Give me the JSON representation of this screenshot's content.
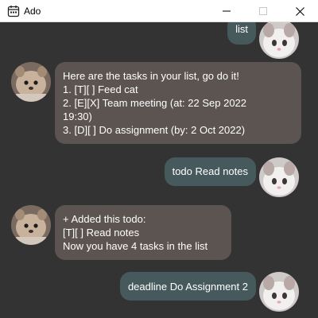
{
  "window": {
    "title": "Ado",
    "icon": "calendar-icon",
    "controls": [
      "minimize-icon",
      "maximize-icon",
      "close-icon"
    ]
  },
  "colors": {
    "background": "#333333",
    "user_bubble": "#465a5d",
    "bot_bubble": "#5b5450",
    "text": "#ffffff"
  },
  "messages": [
    {
      "sender": "user",
      "text": "list"
    },
    {
      "sender": "bot",
      "text": "Here are the tasks in your list, go do it!\n1. [T][ ] Feed cat\n2. [E][X] Team meeting (at: 22 Sep 2022\n19:30)\n3. [D][ ] Do assignment (by: 2 Oct 2022)"
    },
    {
      "sender": "user",
      "text": "todo Read notes"
    },
    {
      "sender": "bot",
      "text": "+ Added this todo:\n[T][ ] Read notes\nNow you have 4 tasks in the list"
    },
    {
      "sender": "user",
      "text": "deadline Do Assignment 2"
    }
  ]
}
